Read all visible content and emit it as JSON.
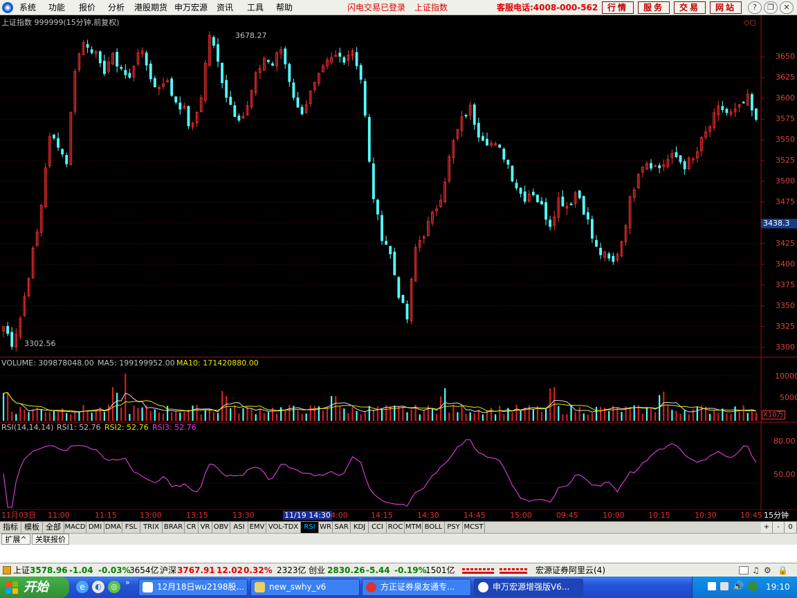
{
  "menu": {
    "items": [
      "系统",
      "功能",
      "报价",
      "分析",
      "港股期货",
      "申万宏源",
      "资讯",
      "工具",
      "帮助"
    ],
    "status_login": "闪电交易已登录",
    "index_name": "上证指数",
    "hotline": "客服电话:4008-000-562",
    "buttons": [
      "行情",
      "服务",
      "交易",
      "网站"
    ]
  },
  "main_chart": {
    "title": "上证指数 999999(15分钟,前复权)",
    "high_label": "3678.27",
    "low_label": "3302.56",
    "current_price": "3438.3"
  },
  "volume_panel": {
    "label": "VOLUME: 309878048.00",
    "ma5": "MA5: 199199952.00",
    "ma10": "MA10: 171420880.00",
    "y_ticks": [
      "10000",
      "5000"
    ],
    "unit": "X10万"
  },
  "rsi_panel": {
    "label": "RSI(14,14,14)",
    "rsi1": "RSI1: 52.76",
    "rsi2": "RSI2: 52.76",
    "rsi3": "RSI3: 52.76",
    "y_ticks": [
      "80.00",
      "50.00"
    ]
  },
  "x_axis": {
    "labels": [
      "11月03日",
      "11:00",
      "11:15",
      "13:00",
      "13:15",
      "13:30",
      "11/19 14:30",
      "4:00",
      "14:15",
      "14:30",
      "14:45",
      "15:00",
      "09:45",
      "10:00",
      "10:15",
      "10:30",
      "10:45"
    ],
    "period_button": "15分钟"
  },
  "indicator_tabs": [
    "指标",
    "模板",
    "全部",
    "MACD",
    "DMI",
    "DMA",
    "FSL",
    "TRIX",
    "BRAR",
    "CR",
    "VR",
    "OBV",
    "ASI",
    "EMV",
    "VOL-TDX",
    "RSI",
    "WR",
    "SAR",
    "KDJ",
    "CCI",
    "ROC",
    "MTM",
    "BOLL",
    "PSY",
    "MCST"
  ],
  "active_tab": "RSI",
  "tab_controls": [
    "+",
    "-",
    "0"
  ],
  "sub_tabs": [
    "扩展^",
    "关联报价"
  ],
  "status_bar": {
    "sh_name": "上证",
    "sh_price": "3578.96",
    "sh_change": "-1.04",
    "sh_pct": "-0.03%",
    "sh_amount": "3654亿",
    "hs_name": "沪深",
    "hs_price": "3767.91",
    "hs_change": "12.02",
    "hs_pct": "0.32%",
    "hs_amount": "2323亿",
    "cy_name": "创业",
    "cy_price": "2830.26",
    "cy_change": "-5.44",
    "cy_pct": "-0.19%",
    "cy_amount": "1501亿",
    "broker": "宏源证券阿里云(4)"
  },
  "taskbar": {
    "start": "开始",
    "tasks": [
      "12月18日wu2198股...",
      "new_swhy_v6",
      "方正证券泉友通专...",
      "申万宏源增强版V6..."
    ],
    "clock": "19:10"
  },
  "chart_data": {
    "type": "candlestick",
    "title": "上证指数 999999(15分钟,前复权)",
    "price_axis": {
      "ticks": [
        "3650",
        "3625",
        "3600",
        "3575",
        "3550",
        "3525",
        "3500",
        "3475",
        "3450",
        "3425",
        "3400",
        "3375",
        "3350",
        "3325",
        "3300"
      ],
      "ylim": [
        3288,
        3697
      ]
    },
    "price_marks": {
      "high": 3678.27,
      "low": 3302.56,
      "last": 3438.3
    },
    "close_path": [
      3325,
      3305,
      3340,
      3400,
      3450,
      3550,
      3550,
      3520,
      3640,
      3670,
      3660,
      3630,
      3650,
      3640,
      3620,
      3660,
      3640,
      3610,
      3625,
      3600,
      3590,
      3560,
      3600,
      3678,
      3640,
      3600,
      3580,
      3580,
      3620,
      3650,
      3640,
      3660,
      3620,
      3580,
      3600,
      3620,
      3640,
      3650,
      3650,
      3660,
      3620,
      3500,
      3440,
      3420,
      3370,
      3330,
      3420,
      3440,
      3460,
      3490,
      3540,
      3570,
      3590,
      3560,
      3550,
      3540,
      3530,
      3500,
      3480,
      3490,
      3470,
      3450,
      3480,
      3470,
      3490,
      3460,
      3420,
      3410,
      3400,
      3430,
      3480,
      3520,
      3525,
      3515,
      3525,
      3530,
      3520,
      3525,
      3550,
      3570,
      3590,
      3580,
      3585,
      3600,
      3570
    ],
    "candle_count": 180,
    "volume": {
      "ma5": 199199952.0,
      "ma10": 171420880.0,
      "last": 309878048.0,
      "y_ticks": [
        10000,
        5000
      ],
      "unit": "X10万"
    },
    "rsi": {
      "params": "14,14,14",
      "rsi1": 52.76,
      "rsi2": 52.76,
      "rsi3": 52.76,
      "ylim": [
        26,
        96
      ],
      "y_ticks": [
        80,
        50
      ]
    },
    "x_labels": [
      "11月03日",
      "11:00",
      "11:15",
      "13:00",
      "13:15",
      "13:30",
      "11/19 14:30",
      "4:00",
      "14:15",
      "14:30",
      "14:45",
      "15:00",
      "09:45",
      "10:00",
      "10:15",
      "10:30",
      "10:45"
    ]
  }
}
